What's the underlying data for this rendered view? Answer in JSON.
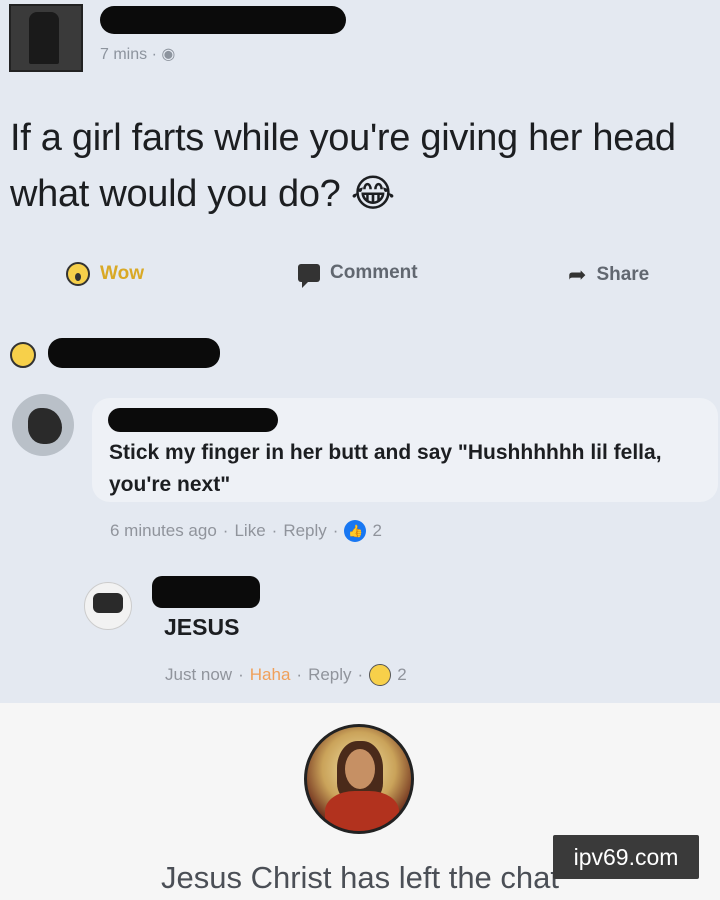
{
  "post": {
    "timestamp": "7 mins · ◉",
    "text": "If a girl farts while you're giving her head what would you do? 😂"
  },
  "actions": {
    "wow_label": "Wow",
    "comment_label": "Comment",
    "share_label": "Share"
  },
  "comments": [
    {
      "text": "Stick my finger in her butt and say \"Hushhhhhh lil fella, you're next\"",
      "meta_time": "6 minutes ago",
      "meta_like": "Like",
      "meta_reply": "Reply",
      "reaction_count": "2"
    },
    {
      "name": "JESUS",
      "meta_time": "Just now",
      "meta_reaction": "Haha",
      "meta_reply": "Reply",
      "reaction_count": "2"
    }
  ],
  "footer": {
    "left_chat_text": "Jesus Christ has left the chat"
  },
  "watermark": "ipv69.com",
  "colors": {
    "background": "#e4e9f1",
    "like_blue": "#1877f2",
    "haha_orange": "#f0a05a",
    "muted_text": "#90949c"
  }
}
